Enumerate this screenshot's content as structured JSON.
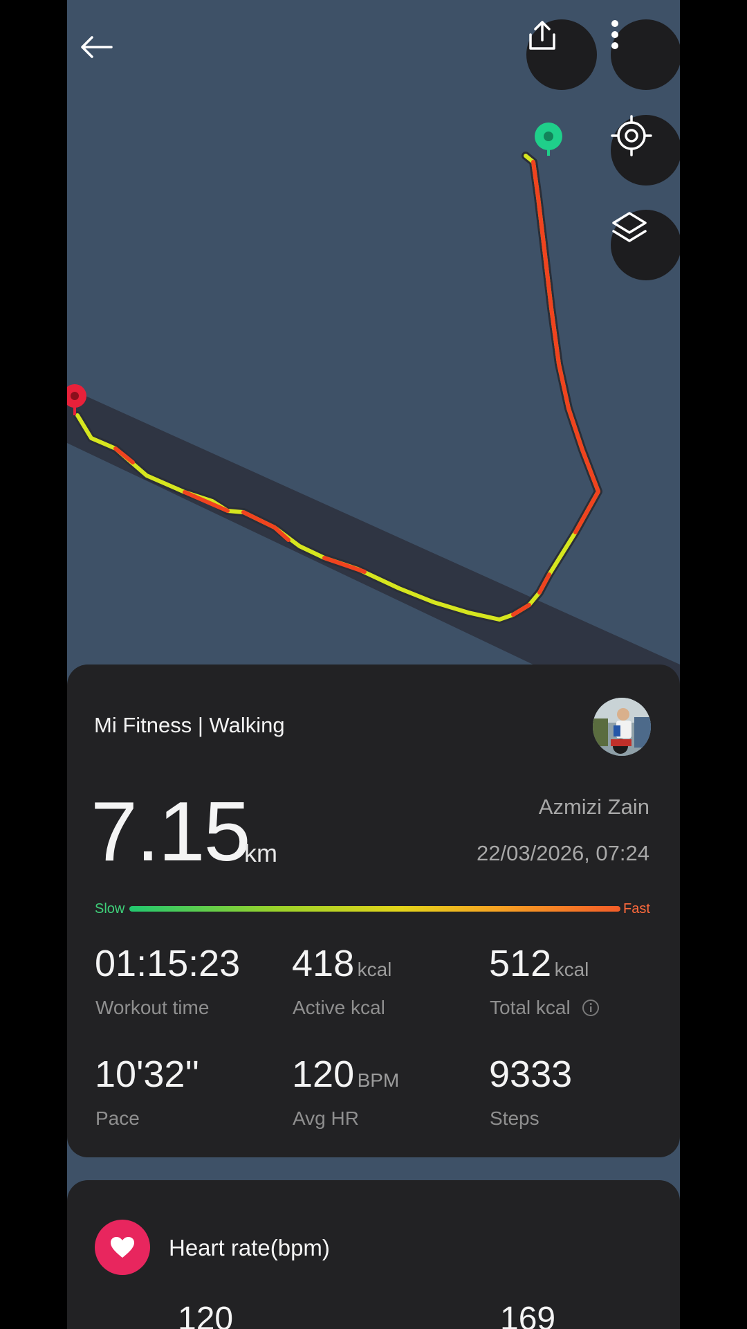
{
  "map": {
    "back_icon": "arrow-left-icon",
    "share_icon": "share-icon",
    "more_icon": "more-vertical-icon",
    "locate_icon": "target-icon",
    "layers_icon": "layers-icon",
    "start_marker_color": "#1fcf8a",
    "end_marker_color": "#e8213a",
    "map_bg": "#3e5167",
    "road_color": "#2f3543"
  },
  "summary": {
    "source": "Mi Fitness | Walking",
    "distance": "7.15",
    "distance_unit": "km",
    "user_name": "Azmizi Zain",
    "datetime": "22/03/2026, 07:24",
    "speed_slow": "Slow",
    "speed_fast": "Fast",
    "stats": [
      {
        "value": "01:15:23",
        "unit": "",
        "label": "Workout time"
      },
      {
        "value": "418",
        "unit": "kcal",
        "label": "Active kcal"
      },
      {
        "value": "512",
        "unit": "kcal",
        "label": "Total kcal",
        "info_icon": "info-icon"
      },
      {
        "value": "10'32''",
        "unit": "",
        "label": "Pace"
      },
      {
        "value": "120",
        "unit": "BPM",
        "label": "Avg HR"
      },
      {
        "value": "9333",
        "unit": "",
        "label": "Steps"
      }
    ]
  },
  "heart": {
    "title": "Heart rate(bpm)",
    "icon": "heart-icon",
    "avg_value": "120",
    "max_value": "169"
  }
}
